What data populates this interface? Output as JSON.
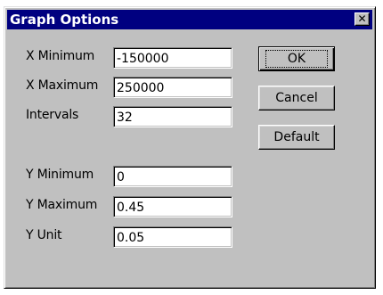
{
  "window": {
    "title": "Graph Options",
    "close_glyph": "✕"
  },
  "x_axis": {
    "minimum_label": "X Minimum",
    "minimum_value": "-150000",
    "maximum_label": "X Maximum",
    "maximum_value": "250000",
    "intervals_label": "Intervals",
    "intervals_value": "32"
  },
  "y_axis": {
    "minimum_label": "Y Minimum",
    "minimum_value": "0",
    "maximum_label": "Y Maximum",
    "maximum_value": "0.45",
    "unit_label": "Y Unit",
    "unit_value": "0.05"
  },
  "buttons": {
    "ok_label": "OK",
    "cancel_label": "Cancel",
    "default_label": "Default"
  },
  "colors": {
    "titlebar": "#000080",
    "face": "#c0c0c0"
  }
}
